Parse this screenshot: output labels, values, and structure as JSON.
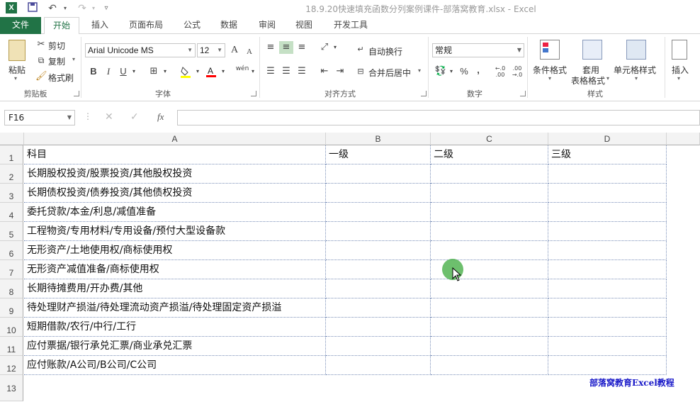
{
  "window": {
    "title": "18.9.20快速填充函数分列案例课件-部落窝教育.xlsx - Excel",
    "logo": "X"
  },
  "tabs": [
    "文件",
    "开始",
    "插入",
    "页面布局",
    "公式",
    "数据",
    "审阅",
    "视图",
    "开发工具"
  ],
  "ribbon": {
    "clipboard": {
      "paste": "粘贴",
      "cut": "剪切",
      "copy": "复制",
      "format_painter": "格式刷",
      "label": "剪贴板"
    },
    "font": {
      "name": "Arial Unicode MS",
      "size": "12",
      "grow": "A",
      "shrink": "A",
      "bold": "B",
      "italic": "I",
      "underline": "U",
      "phonetic": "wén",
      "label": "字体"
    },
    "alignment": {
      "wrap": "自动换行",
      "merge": "合并后居中",
      "label": "对齐方式"
    },
    "number": {
      "format": "常规",
      "percent": "%",
      "comma": ",",
      "label": "数字"
    },
    "styles": {
      "conditional": "条件格式",
      "table_line1": "套用",
      "table_line2": "表格格式",
      "cell_styles": "单元格样式",
      "label": "样式"
    },
    "cells": {
      "insert": "插入"
    }
  },
  "formula_bar": {
    "name_box": "F16",
    "fx": "fx",
    "value": ""
  },
  "columns": [
    "A",
    "B",
    "C",
    "D"
  ],
  "rows": [
    "1",
    "2",
    "3",
    "4",
    "5",
    "6",
    "7",
    "8",
    "9",
    "10",
    "11",
    "12",
    "13"
  ],
  "cells": [
    [
      "科目",
      "一级",
      "二级",
      "三级"
    ],
    [
      "长期股权投资/股票投资/其他股权投资",
      "",
      "",
      ""
    ],
    [
      "长期债权投资/债券投资/其他债权投资",
      "",
      "",
      ""
    ],
    [
      "委托贷款/本金/利息/减值准备",
      "",
      "",
      ""
    ],
    [
      "工程物资/专用材料/专用设备/预付大型设备款",
      "",
      "",
      ""
    ],
    [
      "无形资产/土地使用权/商标使用权",
      "",
      "",
      ""
    ],
    [
      "无形资产减值准备/商标使用权",
      "",
      "",
      ""
    ],
    [
      "长期待摊费用/开办费/其他",
      "",
      "",
      ""
    ],
    [
      "待处理财产损溢/待处理流动资产损溢/待处理固定资产损溢",
      "",
      "",
      ""
    ],
    [
      "短期借款/农行/中行/工行",
      "",
      "",
      ""
    ],
    [
      "应付票据/银行承兑汇票/商业承兑汇票",
      "",
      "",
      ""
    ],
    [
      "应付账款/A公司/B公司/C公司",
      "",
      "",
      ""
    ]
  ],
  "watermark": "部落窝教育Excel教程",
  "colors": {
    "excel_green": "#217346",
    "grid_dotted": "#7a8fb8",
    "watermark": "#1818c8"
  }
}
